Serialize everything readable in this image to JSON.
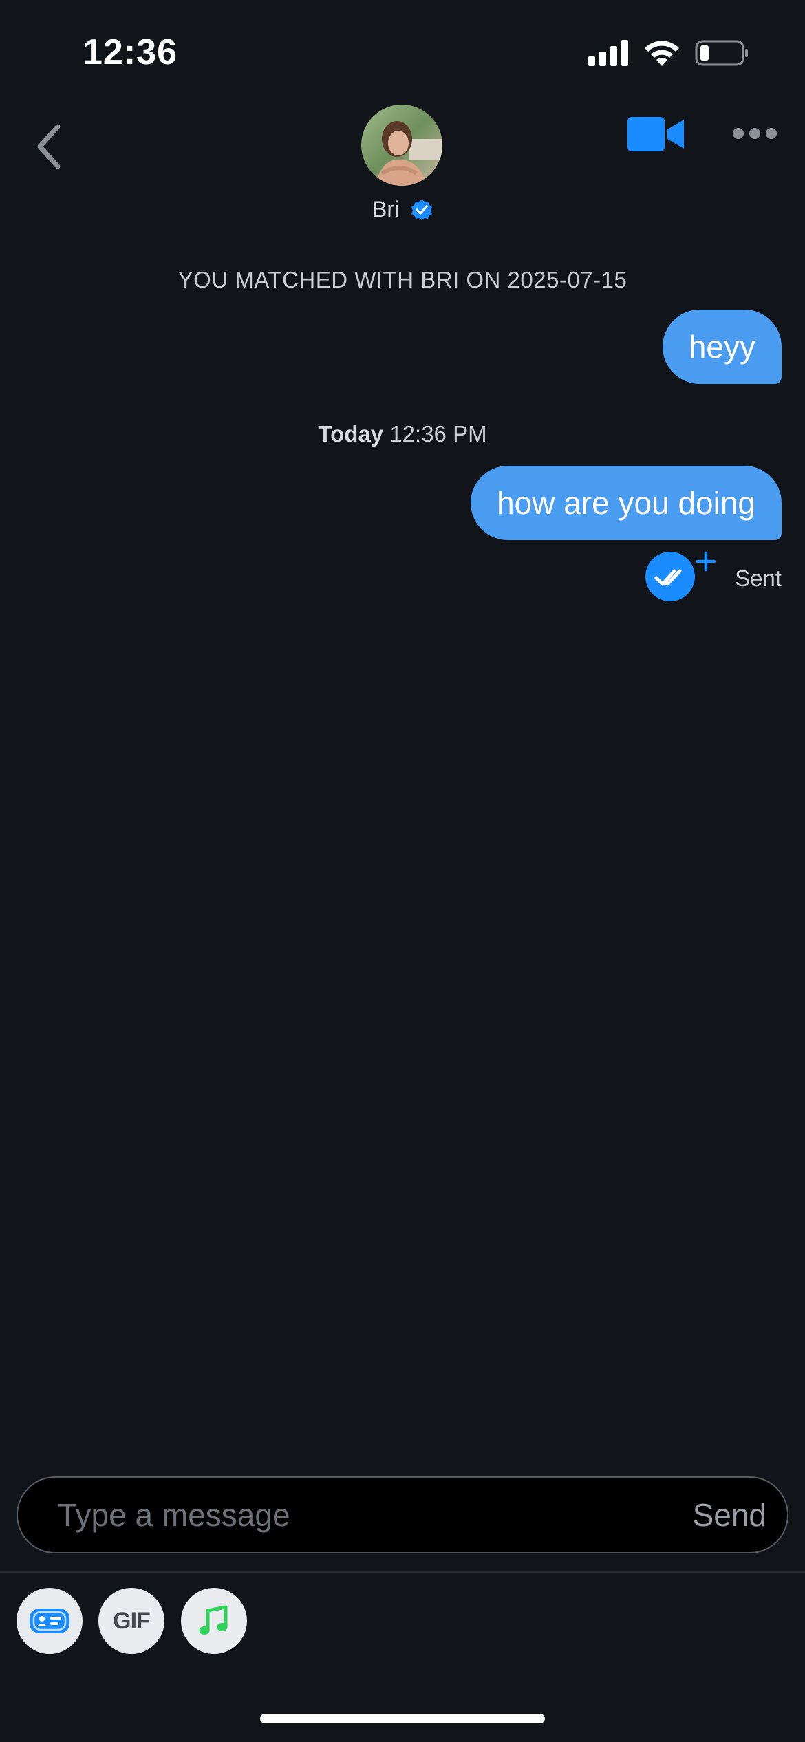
{
  "status_bar": {
    "time": "12:36",
    "icons": [
      "signal-icon",
      "wifi-icon",
      "battery-icon"
    ]
  },
  "header": {
    "name": "Bri",
    "verified": true,
    "icons": {
      "back": "chevron-left-icon",
      "video": "video-camera-icon",
      "more": "more-dots-icon",
      "verified": "verified-badge-icon"
    }
  },
  "conversation": {
    "match_note": "YOU MATCHED WITH BRI ON 2025-07-15",
    "messages": [
      {
        "text": "heyy",
        "from": "me"
      },
      {
        "text": "how are you doing",
        "from": "me"
      }
    ],
    "timestamp": {
      "day": "Today",
      "time": "12:36 PM"
    },
    "status": "Sent"
  },
  "composer": {
    "placeholder": "Type a message",
    "value": "",
    "send_label": "Send"
  },
  "tools": {
    "gif_label": "GIF",
    "icons": [
      "profile-card-icon",
      "gif-icon",
      "music-note-icon"
    ]
  },
  "colors": {
    "background": "#111419",
    "accent": "#1a8cff",
    "bubble": "#4a9cf0",
    "music_green": "#2fd35a"
  }
}
